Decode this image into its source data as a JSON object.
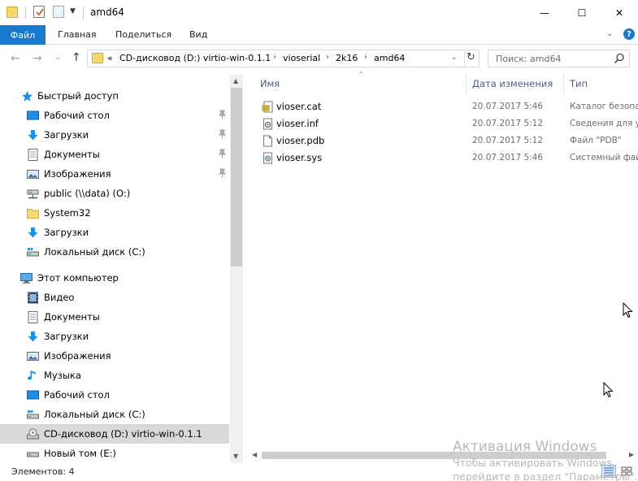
{
  "window": {
    "title": "amd64",
    "minimize_glyph": "—",
    "maximize_glyph": "☐",
    "close_glyph": "✕"
  },
  "ribbon": {
    "tabs": [
      "Файл",
      "Главная",
      "Поделиться",
      "Вид"
    ],
    "collapse_glyph": "⌄",
    "help_glyph": "?"
  },
  "navigation": {
    "back_glyph": "←",
    "forward_glyph": "→",
    "recent_glyph": "⌄",
    "up_glyph": "↑",
    "overflow_glyph": "«",
    "breadcrumbs": [
      "CD-дисковод (D:) virtio-win-0.1.1",
      "vioserial",
      "2k16",
      "amd64"
    ],
    "separator_glyph": "›",
    "dropdown_glyph": "⌄",
    "refresh_glyph": "↻",
    "search_placeholder": "Поиск: amd64"
  },
  "sidebar": {
    "quick_access": {
      "label": "Быстрый доступ",
      "items": [
        {
          "label": "Рабочий стол",
          "icon": "desktop-icon",
          "pinned": true
        },
        {
          "label": "Загрузки",
          "icon": "downloads-icon",
          "pinned": true
        },
        {
          "label": "Документы",
          "icon": "documents-icon",
          "pinned": true
        },
        {
          "label": "Изображения",
          "icon": "pictures-icon",
          "pinned": true
        },
        {
          "label": "public (\\\\data) (O:)",
          "icon": "network-drive-icon",
          "pinned": false
        },
        {
          "label": "System32",
          "icon": "folder-icon",
          "pinned": false
        },
        {
          "label": "Загрузки",
          "icon": "downloads-icon",
          "pinned": false
        },
        {
          "label": "Локальный диск (C:)",
          "icon": "local-disk-icon",
          "pinned": false
        }
      ]
    },
    "this_pc": {
      "label": "Этот компьютер",
      "items": [
        {
          "label": "Видео",
          "icon": "video-icon"
        },
        {
          "label": "Документы",
          "icon": "documents-icon"
        },
        {
          "label": "Загрузки",
          "icon": "downloads-icon"
        },
        {
          "label": "Изображения",
          "icon": "pictures-icon"
        },
        {
          "label": "Музыка",
          "icon": "music-icon"
        },
        {
          "label": "Рабочий стол",
          "icon": "desktop-icon"
        },
        {
          "label": "Локальный диск (C:)",
          "icon": "local-disk-icon"
        },
        {
          "label": "CD-дисковод (D:) virtio-win-0.1.1",
          "icon": "cd-drive-icon",
          "selected": true
        },
        {
          "label": "Новый том (E:)",
          "icon": "drive-icon"
        }
      ]
    }
  },
  "file_list": {
    "columns": [
      "Имя",
      "Дата изменения",
      "Тип"
    ],
    "sort_glyph": "^",
    "rows": [
      {
        "name": "vioser.cat",
        "date": "20.07.2017 5:46",
        "type": "Каталог безопасности",
        "icon": "catalog-file-icon"
      },
      {
        "name": "vioser.inf",
        "date": "20.07.2017 5:12",
        "type": "Сведения для установки",
        "icon": "setup-info-file-icon"
      },
      {
        "name": "vioser.pdb",
        "date": "20.07.2017 5:12",
        "type": "Файл \"PDB\"",
        "icon": "pdb-file-icon"
      },
      {
        "name": "vioser.sys",
        "date": "20.07.2017 5:46",
        "type": "Системный файл",
        "icon": "system-file-icon"
      }
    ]
  },
  "scroll": {
    "up_glyph": "▲",
    "down_glyph": "▼",
    "left_glyph": "◀",
    "right_glyph": "▶"
  },
  "status": {
    "item_count": "Элементов: 4"
  },
  "watermark": {
    "title": "Активация Windows",
    "line1": "Чтобы активировать Windows,",
    "line2": "перейдите в раздел \"Параметры\"."
  }
}
